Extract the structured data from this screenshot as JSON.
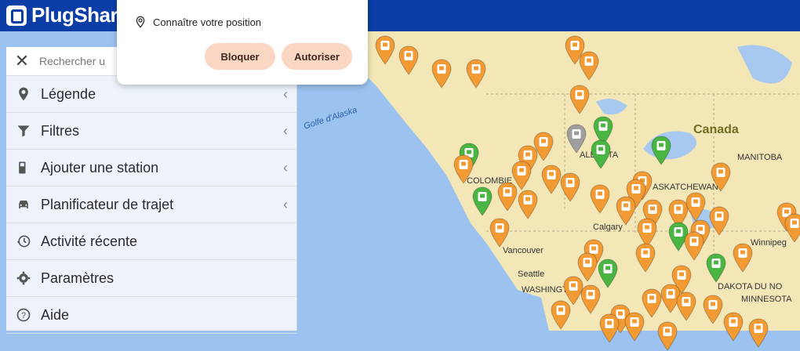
{
  "app": {
    "brand": "PlugShare"
  },
  "permission_popup": {
    "message": "Connaître votre position",
    "block_label": "Bloquer",
    "allow_label": "Autoriser"
  },
  "sidebar": {
    "search_placeholder": "Rechercher u",
    "items": [
      {
        "label": "Légende",
        "icon": "map-pin-icon",
        "expandable": true
      },
      {
        "label": "Filtres",
        "icon": "filter-icon",
        "expandable": true
      },
      {
        "label": "Ajouter une station",
        "icon": "gas-pump-icon",
        "expandable": true
      },
      {
        "label": "Planificateur de trajet",
        "icon": "car-icon",
        "expandable": true
      },
      {
        "label": "Activité récente",
        "icon": "history-icon",
        "expandable": false
      },
      {
        "label": "Paramètres",
        "icon": "gear-icon",
        "expandable": false
      },
      {
        "label": "Aide",
        "icon": "help-icon",
        "expandable": false
      }
    ]
  },
  "map": {
    "labels": {
      "canada": "Canada",
      "alaska_gulf": "Golfe d'Alaska",
      "alberta": "ALBERTA",
      "colombie": "COLOMBIE",
      "saskatchewan": "ASKATCHEWAN",
      "manitoba": "MANITOBA",
      "calgary": "Calgary",
      "vancouver": "Vancouver",
      "seattle": "Seattle",
      "washington": "WASHINGTON",
      "winnipeg": "Winnipeg",
      "minnesota": "MINNESOTA",
      "dakota": "DAKOTA DU NO"
    }
  },
  "colors": {
    "header": "#0a3ea6",
    "pin_orange": "#f29a33",
    "pin_green": "#4bb543",
    "pin_gray": "#9e9e9e",
    "button_bg": "#fbd6c2"
  }
}
